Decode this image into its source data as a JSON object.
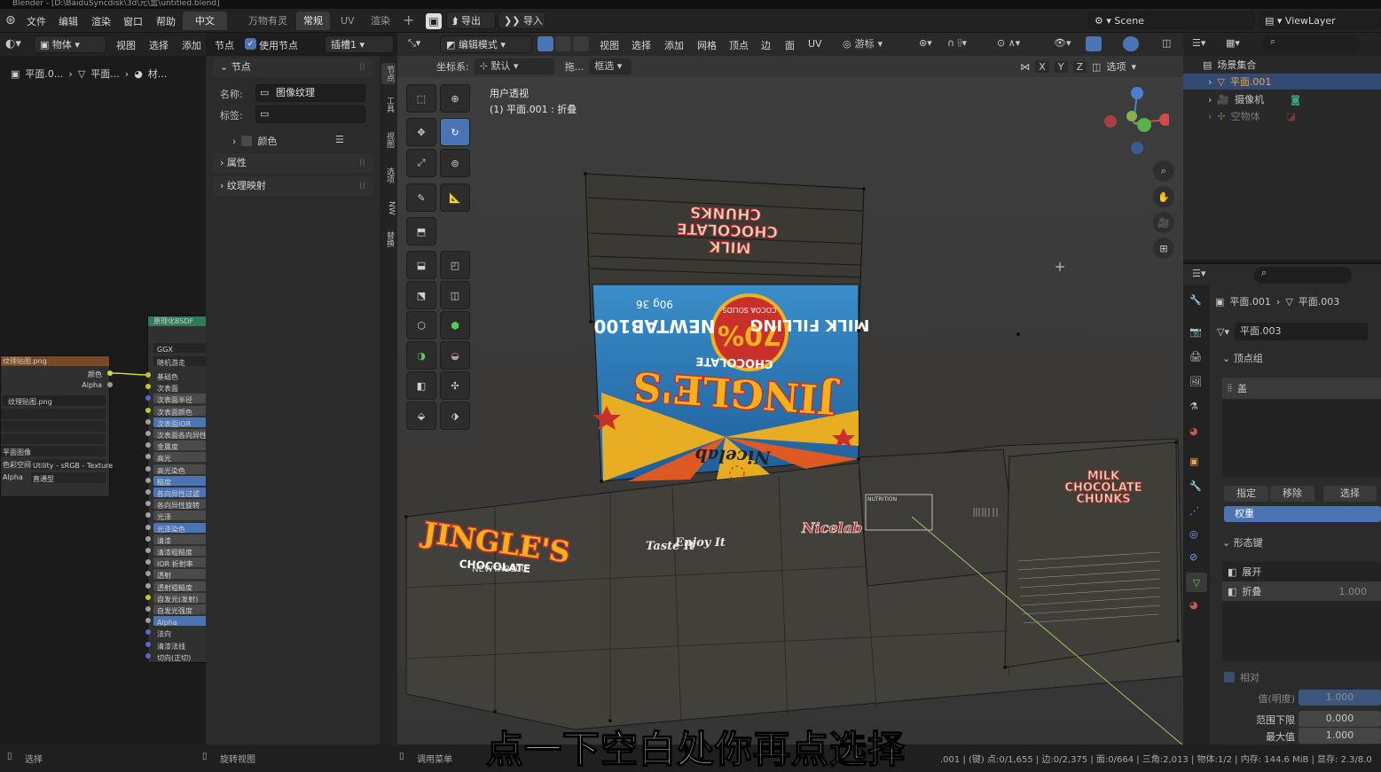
{
  "title": "Blender - [D:\\BaiduSyncdisk\\3d\\元\\盒\\untitled.blend]",
  "menu": [
    "文件",
    "编辑",
    "渲染",
    "窗口",
    "帮助"
  ],
  "language": "中文",
  "workspaces": [
    "万物有灵",
    "常规",
    "UV",
    "渲染"
  ],
  "active_workspace": "常规",
  "export_label": "导出",
  "import_label": "导入",
  "scene": "Scene",
  "view_layer": "ViewLayer",
  "node_editor": {
    "object_mode": "物体",
    "menus": [
      "视图",
      "选择",
      "添加",
      "节点"
    ],
    "use_nodes": "使用节点",
    "slot": "插槽1",
    "breadcrumb": [
      "平面.0...",
      "平面...",
      "材..."
    ],
    "tex_node_title": "纹理贴图.png",
    "tex_outputs": [
      "颜色",
      "Alpha"
    ],
    "tex_image": "纹理贴图.png",
    "tex_colorspace": "Utility - sRGB - Texture",
    "tex_mode": "直通型",
    "tex_proj": "平面图像",
    "tex_label_space": "色彩空间",
    "tex_label_alpha": "Alpha",
    "bsdf_title": "原理化BSDF",
    "bsdf_dist": "GGX",
    "bsdf_sss": "随机游走",
    "bsdf_inputs": [
      "基础色",
      "次表面",
      "次表面半径",
      "次表面颜色",
      "次表面IOR",
      "次表面各向异性",
      "金属度",
      "高光",
      "高光染色",
      "糙度",
      "各向异性过滤",
      "各向异性旋转",
      "光泽",
      "光泽染色",
      "清漆",
      "清漆粗糙度",
      "IOR 折射率",
      "透射",
      "透射粗糙度",
      "自发光(发射)",
      "自发光强度",
      "Alpha",
      "法向",
      "清漆法线",
      "切向(正切)"
    ]
  },
  "npanel": {
    "node_section": "节点",
    "name_label": "名称:",
    "name_value": "图像纹理",
    "tag_label": "标签:",
    "color_label": "颜色",
    "props_section": "属性",
    "mapping_section": "纹理映射",
    "tabs": [
      "节点",
      "工具",
      "视图",
      "选项",
      "NW",
      "替换"
    ]
  },
  "viewport": {
    "mode": "编辑模式",
    "menus": [
      "视图",
      "选择",
      "添加",
      "网格",
      "顶点",
      "边",
      "面",
      "UV"
    ],
    "coord_label": "坐标系:",
    "coord_value": "默认",
    "drag_label": "拖...",
    "select_mode": "框选",
    "snap_label": "游标",
    "axes": [
      "X",
      "Y",
      "Z"
    ],
    "options_label": "选项",
    "view_name": "用户透视",
    "object_info": "(1) 平面.001 : 折叠"
  },
  "outliner": {
    "root": "场景集合",
    "items": [
      "平面.001",
      "摄像机",
      "空物体"
    ]
  },
  "properties": {
    "breadcrumb_obj": "平面.001",
    "breadcrumb_mesh": "平面.003",
    "mesh_name": "平面.003",
    "vgroup_section": "顶点组",
    "vgroup_item": "盖",
    "assign": "指定",
    "remove": "移除",
    "select": "选择",
    "weight": "权重",
    "shapekey_section": "形态键",
    "shapekeys": [
      {
        "name": "展开",
        "value": ""
      },
      {
        "name": "折叠",
        "value": "1.000"
      }
    ],
    "relative_label": "相对",
    "value_label": "值(明度)",
    "value": "1.000",
    "range_min_label": "范围下限",
    "range_min": "0.000",
    "max_label": "最大值",
    "max": "1.000"
  },
  "status": {
    "select": "选择",
    "rotate": "旋转视图",
    "menu": "调用菜单",
    "stats": ".001 | (键) 点:0/1,655 | 边:0/2,375 | 面:0/664 | 三角:2,013 | 物体:1/2 | 内存: 144.6 MiB | 显存: 2.3/8.0"
  },
  "subtitle": "点一下空白处你再点选择",
  "package": {
    "top_panel_text": [
      "MILK",
      "CHOCOLATE",
      "CHUNKS"
    ],
    "brand": "JINGLE'S",
    "brand_sub": "CHOCOLATE",
    "percent": "70%",
    "percent_sub": "COCOA SOLIDS",
    "weight": "90g 36",
    "newtab": "NEWTAB100",
    "filling": "MILK FILLING",
    "nicelab": "Nicelab",
    "taste": "Taste It",
    "enjoy": "Enjoy It",
    "nutrition": "NUTRITION"
  },
  "colors": {
    "accent": "#4a74b4",
    "select_blue": "#5487d9",
    "brand_red": "#c8302a",
    "brand_yellow": "#f2b21d",
    "brand_blue": "#2a78b8"
  }
}
